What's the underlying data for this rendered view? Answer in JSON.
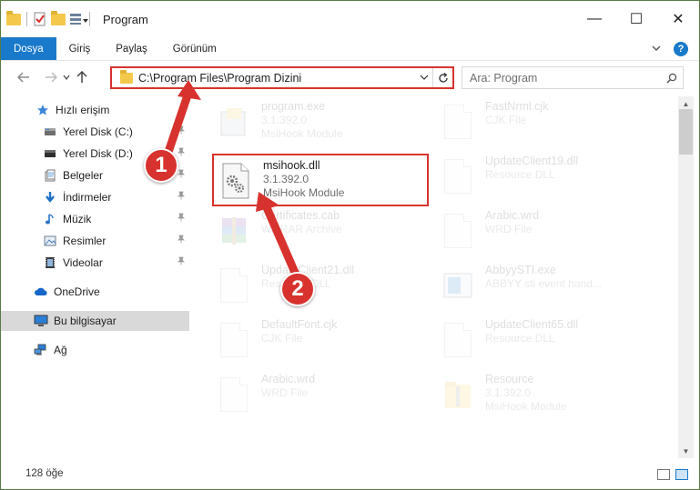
{
  "window": {
    "title": "Program",
    "controls": {
      "minimize": "—",
      "maximize": "☐",
      "close": "✕"
    }
  },
  "ribbon": {
    "tabs": [
      "Dosya",
      "Giriş",
      "Paylaş",
      "Görünüm"
    ],
    "expand_icon": "chevron-down-icon",
    "help_label": "?"
  },
  "nav": {
    "address": "C:\\Program Files\\Program Dizini",
    "search_placeholder": "Ara: Program"
  },
  "sidebar": {
    "items": [
      {
        "label": "Hızlı erişim",
        "icon": "star-icon",
        "pinned": false,
        "selected": false
      },
      {
        "label": "Yerel Disk (C:)",
        "icon": "drive-icon",
        "pinned": true,
        "selected": false
      },
      {
        "label": "Yerel Disk (D:)",
        "icon": "drive-icon",
        "pinned": true,
        "selected": false
      },
      {
        "label": "Belgeler",
        "icon": "documents-icon",
        "pinned": true,
        "selected": false
      },
      {
        "label": "İndirmeler",
        "icon": "download-icon",
        "pinned": true,
        "selected": false
      },
      {
        "label": "Müzik",
        "icon": "music-icon",
        "pinned": true,
        "selected": false
      },
      {
        "label": "Resimler",
        "icon": "pictures-icon",
        "pinned": true,
        "selected": false
      },
      {
        "label": "Videolar",
        "icon": "videos-icon",
        "pinned": true,
        "selected": false
      },
      {
        "label": "OneDrive",
        "icon": "cloud-icon",
        "pinned": false,
        "selected": false
      },
      {
        "label": "Bu bilgisayar",
        "icon": "computer-icon",
        "pinned": false,
        "selected": true
      },
      {
        "label": "Ağ",
        "icon": "network-icon",
        "pinned": false,
        "selected": false
      }
    ]
  },
  "files": [
    {
      "name": "program.exe",
      "line2": "3.1.392.0",
      "line3": "MsiHook Module",
      "icon": "exe-icon",
      "highlighted": false
    },
    {
      "name": "FastNrml.cjk",
      "line2": "CJK File",
      "line3": "",
      "icon": "document-icon",
      "highlighted": false
    },
    {
      "name": "msihook.dll",
      "line2": "3.1.392.0",
      "line3": "MsiHook Module",
      "icon": "dll-gear-icon",
      "highlighted": true
    },
    {
      "name": "UpdateClient19.dll",
      "line2": "Resource DLL",
      "line3": "",
      "icon": "dll-gear-icon",
      "highlighted": false
    },
    {
      "name": "Certificates.cab",
      "line2": "WinRAR Archive",
      "line3": "",
      "icon": "winrar-icon",
      "highlighted": false
    },
    {
      "name": "Arabic.wrd",
      "line2": "WRD File",
      "line3": "",
      "icon": "document-icon",
      "highlighted": false
    },
    {
      "name": "UpdateClient21.dll",
      "line2": "Resource DLL",
      "line3": "",
      "icon": "dll-gear-icon",
      "highlighted": false
    },
    {
      "name": "AbbyySTI.exe",
      "line2": "ABBYY sti event hand...",
      "line3": "",
      "icon": "exe-icon",
      "highlighted": false
    },
    {
      "name": "DefaultFont.cjk",
      "line2": "CJK File",
      "line3": "",
      "icon": "document-icon",
      "highlighted": false
    },
    {
      "name": "UpdateClient65.dll",
      "line2": "Resource DLL",
      "line3": "",
      "icon": "dll-gear-icon",
      "highlighted": false
    },
    {
      "name": "Arabic.wrd",
      "line2": "WRD File",
      "line3": "",
      "icon": "document-icon",
      "highlighted": false
    },
    {
      "name": "Resource",
      "line2": "3.1.392.0",
      "line3": "MsiHook Module",
      "icon": "zip-folder-icon",
      "highlighted": false
    }
  ],
  "status": {
    "item_count": "128 öğe"
  },
  "annotations": [
    {
      "label": "1",
      "color": "#d8322e"
    },
    {
      "label": "2",
      "color": "#d8322e"
    }
  ],
  "colors": {
    "accent": "#1979ca",
    "highlight": "#d8322e",
    "selected_bg": "#d9d9d9"
  }
}
